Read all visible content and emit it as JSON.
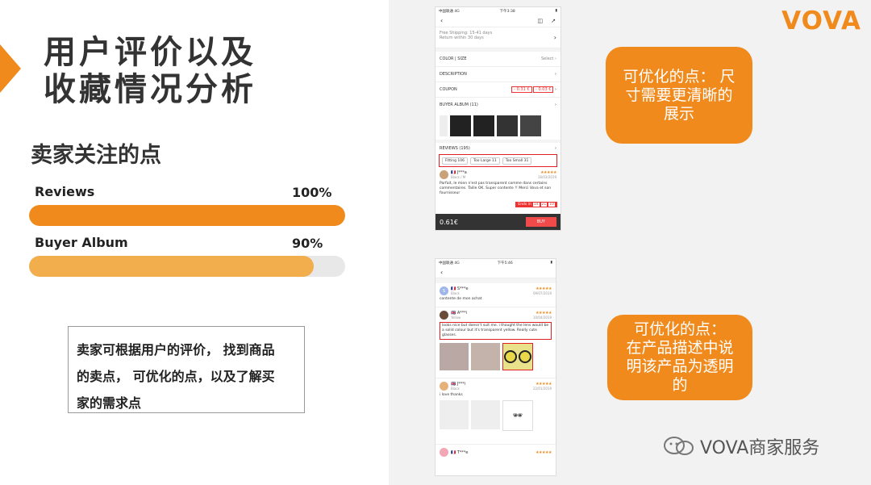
{
  "title_lines": [
    "用户评价以及",
    "收藏情况分析"
  ],
  "subtitle": "卖家关注的点",
  "metrics": [
    {
      "label": "Reviews",
      "value_text": "100%",
      "fraction": 1.0,
      "color": "#f08a1c"
    },
    {
      "label": "Buyer Album",
      "value_text": "90%",
      "fraction": 0.9,
      "color": "#f2ad4d"
    }
  ],
  "note_lines": [
    "卖家可根据用户的评价， 找到商品",
    "的卖点， 可优化的点，以及了解买",
    "家的需求点"
  ],
  "logo": "VOVA",
  "callout1_lines": [
    "可优化的点： 尺",
    "寸需要更清晰的",
    "展示"
  ],
  "callout2_lines": [
    "可优化的点：",
    "在产品描述中说",
    "明该产品为透明",
    "的"
  ],
  "footer_brand": "VOVA商家服务",
  "phone1": {
    "status_left": "中国联通 4G",
    "status_time": "下午3:38",
    "shipping": "Free Shipping: 15-41 days",
    "return": "Return within 30 days",
    "color_size": "COLOR | SIZE",
    "select": "Select",
    "description": "DESCRIPTION",
    "coupon": "COUPON",
    "coupon_a": "- 0.31 €",
    "coupon_b": "- 0.03 €",
    "buyer_album": "BUYER ALBUM (11)",
    "reviews": "REVIEWS (195)",
    "fit_tags": [
      "Fitting 106",
      "Too Large 11",
      "Too Small 31"
    ],
    "reviewer": "J***a",
    "reviewer_sub": "Black / M",
    "review_date": "16/03/2019",
    "review_text": "Parfait, le mien n'est pas transparent comme dans certains commentaires. Taille OK. Super contente !! Merci Vova et son fournisseur",
    "ends_in": "Ends in",
    "timer": [
      "14",
      "21",
      "10"
    ],
    "price": "0.61€",
    "buy": "BUY"
  },
  "phone2": {
    "status_left": "中国联通 4G",
    "status_time": "下午5:46",
    "reviews": [
      {
        "initial": "S",
        "name": "S***e",
        "sub": "Black",
        "date": "09/07/2019",
        "text": "contente de mon achat"
      },
      {
        "initial": "",
        "name": "A***i",
        "sub": "Yellow",
        "date": "10/04/2019",
        "text": "looks nice but doesn't suit me. i thought the lens would be a solid colour but it's transparent yellow. Really cute glasses."
      },
      {
        "initial": "",
        "name": "J***i",
        "sub": "Black",
        "date": "22/01/2019",
        "text": "i love  thanks"
      },
      {
        "initial": "",
        "name": "T***e",
        "sub": "",
        "date": "",
        "text": ""
      }
    ]
  }
}
